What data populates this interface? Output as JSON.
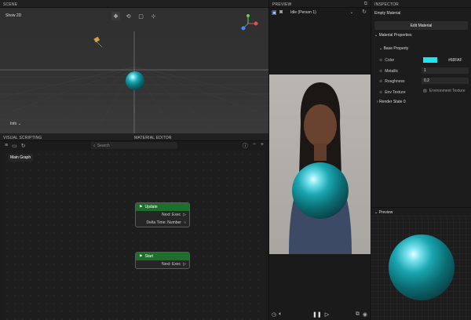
{
  "scene": {
    "title": "SCENE",
    "mode_label": "Show 2D",
    "info_label": "Info",
    "tools": [
      "move-icon",
      "rotate-icon",
      "scale-icon",
      "rect-icon"
    ]
  },
  "visual_scripting": {
    "title": "VISUAL SCRIPTING",
    "editor_title": "MATERIAL EDITOR",
    "search_placeholder": "Search",
    "graph_tab": "Main Graph",
    "nodes": [
      {
        "name": "Update",
        "rows": [
          "Next: Exec",
          "Delta Time: Number"
        ]
      },
      {
        "name": "Start",
        "rows": [
          "Next: Exec"
        ]
      }
    ]
  },
  "preview": {
    "title": "PREVIEW",
    "animation": "Idle (Person 1)"
  },
  "inspector": {
    "title": "INSPECTOR",
    "material_name": "Empty Material",
    "edit_button": "Edit Material",
    "section_material": "Material Properties",
    "section_base": "Base Property",
    "props": {
      "color_label": "Color",
      "color_value": "#68FAF",
      "metallic_label": "Metallic",
      "metallic_value": "1",
      "roughness_label": "Roughness",
      "roughness_value": "0.2",
      "env_label": "Env Texture",
      "env_value": "Environment Texture"
    },
    "render_state": "Render State 0",
    "preview_label": "Preview"
  },
  "colors": {
    "swatch": "#19e6f0",
    "node_header": "#1f6f2c"
  }
}
